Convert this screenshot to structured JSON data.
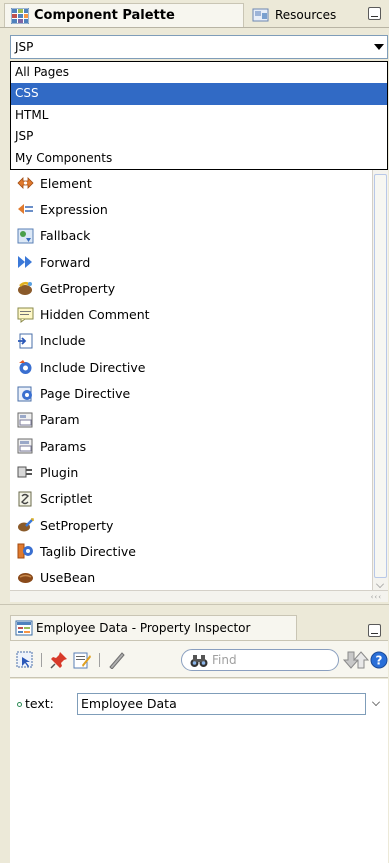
{
  "palette_tabs": {
    "active_label": "Component Palette",
    "inactive_label": "Resources"
  },
  "page_combo": {
    "selected": "JSP",
    "options": [
      "All Pages",
      "CSS",
      "HTML",
      "JSP",
      "My Components"
    ],
    "highlighted": "CSS"
  },
  "palette_items": [
    {
      "label": "Element",
      "icon": "element-icon"
    },
    {
      "label": "Expression",
      "icon": "expression-icon"
    },
    {
      "label": "Fallback",
      "icon": "fallback-icon"
    },
    {
      "label": "Forward",
      "icon": "forward-icon"
    },
    {
      "label": "GetProperty",
      "icon": "getproperty-icon"
    },
    {
      "label": "Hidden Comment",
      "icon": "hidden-comment-icon"
    },
    {
      "label": "Include",
      "icon": "include-icon"
    },
    {
      "label": "Include Directive",
      "icon": "include-directive-icon"
    },
    {
      "label": "Page Directive",
      "icon": "page-directive-icon"
    },
    {
      "label": "Param",
      "icon": "param-icon"
    },
    {
      "label": "Params",
      "icon": "params-icon"
    },
    {
      "label": "Plugin",
      "icon": "plugin-icon"
    },
    {
      "label": "Scriptlet",
      "icon": "scriptlet-icon"
    },
    {
      "label": "SetProperty",
      "icon": "setproperty-icon"
    },
    {
      "label": "Taglib Directive",
      "icon": "taglib-directive-icon"
    },
    {
      "label": "UseBean",
      "icon": "usebean-icon"
    }
  ],
  "inspector": {
    "tab_label": "Employee Data - Property Inspector",
    "find_placeholder": "Find",
    "property_label": "text:",
    "property_value": "Employee Data"
  },
  "colors": {
    "selection": "#316ac5",
    "chrome": "#ece9d8"
  }
}
